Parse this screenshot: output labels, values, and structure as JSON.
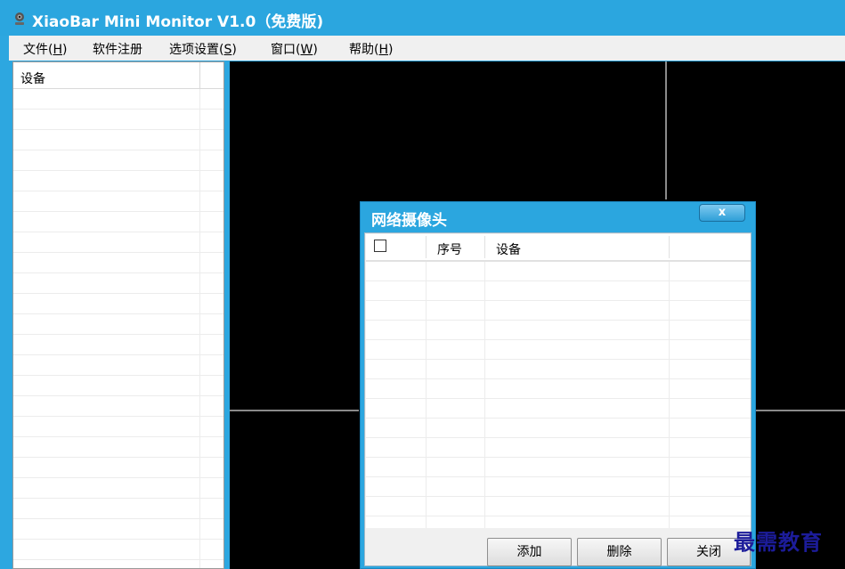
{
  "window": {
    "title": "XiaoBar Mini Monitor V1.0（免费版)",
    "icon": "webcam-icon",
    "accent_color": "#2ba6df"
  },
  "menu": {
    "file": {
      "label": "文件(",
      "hotkey": "H",
      "suffix": ")"
    },
    "register": {
      "label": "软件注册"
    },
    "options": {
      "label": "选项设置(",
      "hotkey": "S",
      "suffix": ")"
    },
    "window": {
      "label": "窗口(",
      "hotkey": "W",
      "suffix": ")"
    },
    "help": {
      "label": "帮助(",
      "hotkey": "H",
      "suffix": ")"
    }
  },
  "device_panel": {
    "header": "设备"
  },
  "dialog": {
    "title": "网络摄像头",
    "close_label": "x",
    "columns": [
      "",
      "序号",
      "设备",
      ""
    ],
    "buttons": {
      "add": "添加",
      "delete": "删除",
      "close": "关闭"
    }
  },
  "watermark": "最需教育"
}
